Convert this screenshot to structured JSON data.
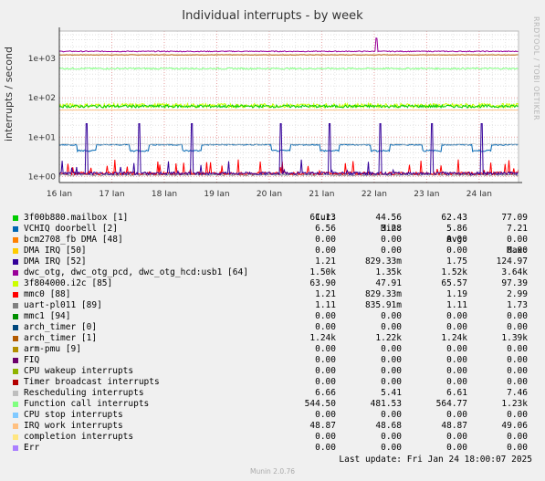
{
  "chart_data": {
    "type": "line",
    "title": "Individual interrupts - by week",
    "ylabel": "interrupts / second",
    "yscale": "log",
    "ylim": [
      0.7,
      5000
    ],
    "yticks": [
      "1e+00",
      "1e+01",
      "1e+02",
      "1e+03"
    ],
    "x_ticks": [
      "16 Jan",
      "17 Jan",
      "18 Jan",
      "19 Jan",
      "20 Jan",
      "21 Jan",
      "22 Jan",
      "23 Jan",
      "24 Jan"
    ],
    "xlim": [
      "16 Jan",
      "24 Jan 18:00"
    ],
    "grid": true,
    "columns": [
      "Cur:",
      "Min:",
      "Avg:",
      "Max:"
    ],
    "series": [
      {
        "name": "3f00b880.mailbox [1]",
        "color": "#00cc00",
        "cur": "61.13",
        "min": "44.56",
        "avg": "62.43",
        "max": "77.09"
      },
      {
        "name": "VCHIQ doorbell [2]",
        "color": "#0066b3",
        "cur": "6.56",
        "min": "3.28",
        "avg": "5.86",
        "max": "7.21"
      },
      {
        "name": "bcm2708_fb DMA [48]",
        "color": "#ff8000",
        "cur": "0.00",
        "min": "0.00",
        "avg": "0.00",
        "max": "0.00"
      },
      {
        "name": "DMA IRQ [50]",
        "color": "#ffcc00",
        "cur": "0.00",
        "min": "0.00",
        "avg": "0.00",
        "max": "0.00"
      },
      {
        "name": "DMA IRQ [52]",
        "color": "#330099",
        "cur": "1.21",
        "min": "829.33m",
        "avg": "1.75",
        "max": "124.97"
      },
      {
        "name": "dwc_otg, dwc_otg_pcd, dwc_otg_hcd:usb1 [64]",
        "color": "#990099",
        "cur": "1.50k",
        "min": "1.35k",
        "avg": "1.52k",
        "max": "3.64k"
      },
      {
        "name": "3f804000.i2c [85]",
        "color": "#ccff00",
        "cur": "63.90",
        "min": "47.91",
        "avg": "65.57",
        "max": "97.39"
      },
      {
        "name": "mmc0 [88]",
        "color": "#ff0000",
        "cur": "1.21",
        "min": "829.33m",
        "avg": "1.19",
        "max": "2.99"
      },
      {
        "name": "uart-pl011 [89]",
        "color": "#808080",
        "cur": "1.11",
        "min": "835.91m",
        "avg": "1.11",
        "max": "1.73"
      },
      {
        "name": "mmc1 [94]",
        "color": "#008f00",
        "cur": "0.00",
        "min": "0.00",
        "avg": "0.00",
        "max": "0.00"
      },
      {
        "name": "arch_timer [0]",
        "color": "#00487d",
        "cur": "0.00",
        "min": "0.00",
        "avg": "0.00",
        "max": "0.00"
      },
      {
        "name": "arch_timer [1]",
        "color": "#b35a00",
        "cur": "1.24k",
        "min": "1.22k",
        "avg": "1.24k",
        "max": "1.39k"
      },
      {
        "name": "arm-pmu [9]",
        "color": "#b38f00",
        "cur": "0.00",
        "min": "0.00",
        "avg": "0.00",
        "max": "0.00"
      },
      {
        "name": "FIQ",
        "color": "#6b006b",
        "cur": "0.00",
        "min": "0.00",
        "avg": "0.00",
        "max": "0.00"
      },
      {
        "name": "CPU wakeup interrupts",
        "color": "#8fb300",
        "cur": "0.00",
        "min": "0.00",
        "avg": "0.00",
        "max": "0.00"
      },
      {
        "name": "Timer broadcast interrupts",
        "color": "#b30000",
        "cur": "0.00",
        "min": "0.00",
        "avg": "0.00",
        "max": "0.00"
      },
      {
        "name": "Rescheduling interrupts",
        "color": "#bebebe",
        "cur": "6.66",
        "min": "5.41",
        "avg": "6.61",
        "max": "7.46"
      },
      {
        "name": "Function call interrupts",
        "color": "#80ff80",
        "cur": "544.50",
        "min": "481.53",
        "avg": "564.77",
        "max": "1.23k"
      },
      {
        "name": "CPU stop interrupts",
        "color": "#80c9ff",
        "cur": "0.00",
        "min": "0.00",
        "avg": "0.00",
        "max": "0.00"
      },
      {
        "name": "IRQ work interrupts",
        "color": "#ffc080",
        "cur": "48.87",
        "min": "48.68",
        "avg": "48.87",
        "max": "49.06"
      },
      {
        "name": "completion interrupts",
        "color": "#ffe680",
        "cur": "0.00",
        "min": "0.00",
        "avg": "0.00",
        "max": "0.00"
      },
      {
        "name": "Err",
        "color": "#aa80ff",
        "cur": "0.00",
        "min": "0.00",
        "avg": "0.00",
        "max": "0.00"
      }
    ]
  },
  "watermark": "RRDTOOL / TOBI OETIKER",
  "last_update": "Last update: Fri Jan 24 18:00:07 2025",
  "footer": "Munin 2.0.76"
}
